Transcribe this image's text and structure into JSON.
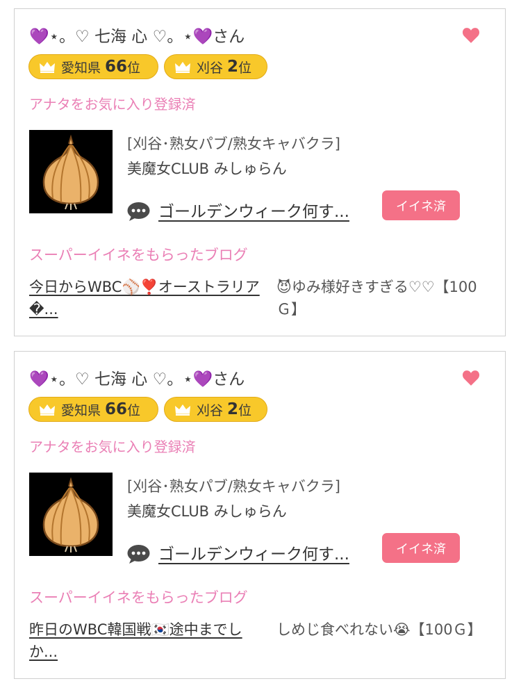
{
  "cards": [
    {
      "user_name": "💜⋆。♡ 七海 心 ♡。⋆💜",
      "user_suffix": "さん",
      "pref_name": "愛知県",
      "pref_rank": "66",
      "area_name": "刈谷",
      "area_rank": "2",
      "rank_unit": "位",
      "registered_text": "アナタをお気に入り登録済",
      "category": "[刈谷･熟女パブ/熟女キャバクラ]",
      "shop_name": "美魔女CLUB みしゅらん",
      "blog_title": "ゴールデンウィーク何す...",
      "liked_label": "イイネ済",
      "super_like_label": "スーパーイイネをもらったブログ",
      "super_blog_title": "今日からWBC⚾❣️オーストラリア�...",
      "super_comment": "😈ゆみ様好きすぎる♡♡【100Ｇ】"
    },
    {
      "user_name": "💜⋆。♡ 七海 心 ♡。⋆💜",
      "user_suffix": "さん",
      "pref_name": "愛知県",
      "pref_rank": "66",
      "area_name": "刈谷",
      "area_rank": "2",
      "rank_unit": "位",
      "registered_text": "アナタをお気に入り登録済",
      "category": "[刈谷･熟女パブ/熟女キャバクラ]",
      "shop_name": "美魔女CLUB みしゅらん",
      "blog_title": "ゴールデンウィーク何す...",
      "liked_label": "イイネ済",
      "super_like_label": "スーパーイイネをもらったブログ",
      "super_blog_title": "昨日のWBC韓国戦🇰🇷途中までしか...",
      "super_comment": "しめじ食べれない😭【100Ｇ】"
    }
  ],
  "colors": {
    "pink_text": "#ea7fb5",
    "badge_yellow": "#f8c82a",
    "liked_button": "#f47187",
    "heart_icon": "#f47187"
  },
  "icons": {
    "favorite": "heart-icon",
    "rank": "crown-icon",
    "blog": "speech-bubble-icon",
    "thumbnail": "onion-image"
  }
}
